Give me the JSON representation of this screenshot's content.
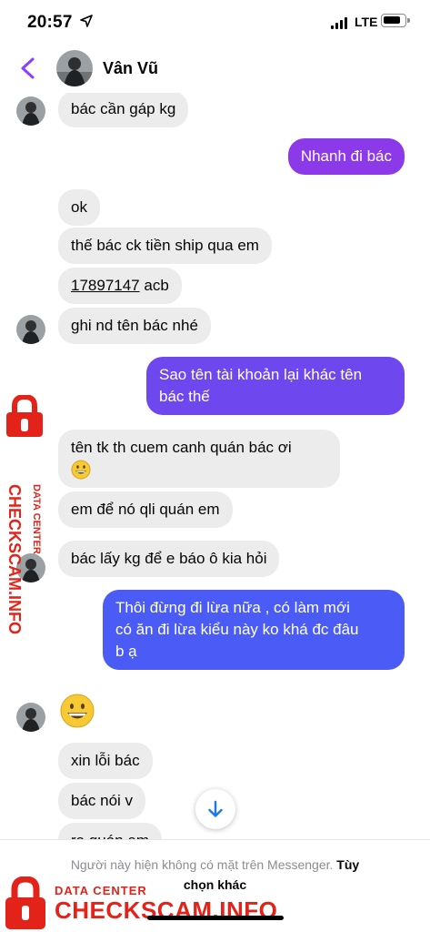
{
  "status_bar": {
    "time": "20:57",
    "network": "LTE",
    "battery_level": 0.85
  },
  "header": {
    "contact_name": "Vân Vũ"
  },
  "messages": [
    {
      "side": "in",
      "text": "bác cần gáp kg"
    },
    {
      "side": "out",
      "text": "Nhanh đi bác"
    },
    {
      "side": "in",
      "text": "ok"
    },
    {
      "side": "in",
      "text": "thế bác ck tiền ship qua em"
    },
    {
      "side": "in",
      "account_number": "17897147",
      "bank": "acb"
    },
    {
      "side": "in",
      "text": "ghi nd tên bác nhé"
    },
    {
      "side": "out",
      "lines": [
        "Sao tên tài khoản lại khác tên",
        "bác thế"
      ]
    },
    {
      "side": "in",
      "text": "tên tk th cuem canh quán bác ơi",
      "emoji": "grinning-face"
    },
    {
      "side": "in",
      "text": "em để nó qli quán em"
    },
    {
      "side": "in",
      "text": "bác lấy kg để e báo ô kia hỏi"
    },
    {
      "side": "out",
      "lines": [
        "Thôi đừng đi lừa nữa , có làm mới",
        "có ăn đi lừa kiểu này ko khá đc đâu",
        "b ạ"
      ]
    },
    {
      "side": "in",
      "emoji": "grinning-face"
    },
    {
      "side": "in",
      "text": "xin lỗi bác"
    },
    {
      "side": "in",
      "text": "bác nói v"
    },
    {
      "side": "in",
      "text": "ra quán em"
    }
  ],
  "footer": {
    "notice_text": "Người này hiện không có mặt trên Messenger.",
    "notice_action_1": "Tùy",
    "notice_action_2": "chọn khác"
  },
  "watermark": {
    "line1": "DATA CENTER",
    "line2": "CHECKSCAM.INFO"
  },
  "colors": {
    "outgoing_top": "#8b39e9",
    "outgoing_mid": "#6a4cf0",
    "outgoing_bottom": "#4a5cf5",
    "incoming": "#ececec",
    "accent": "#8a3ffc",
    "watermark_red": "#e3231a"
  }
}
